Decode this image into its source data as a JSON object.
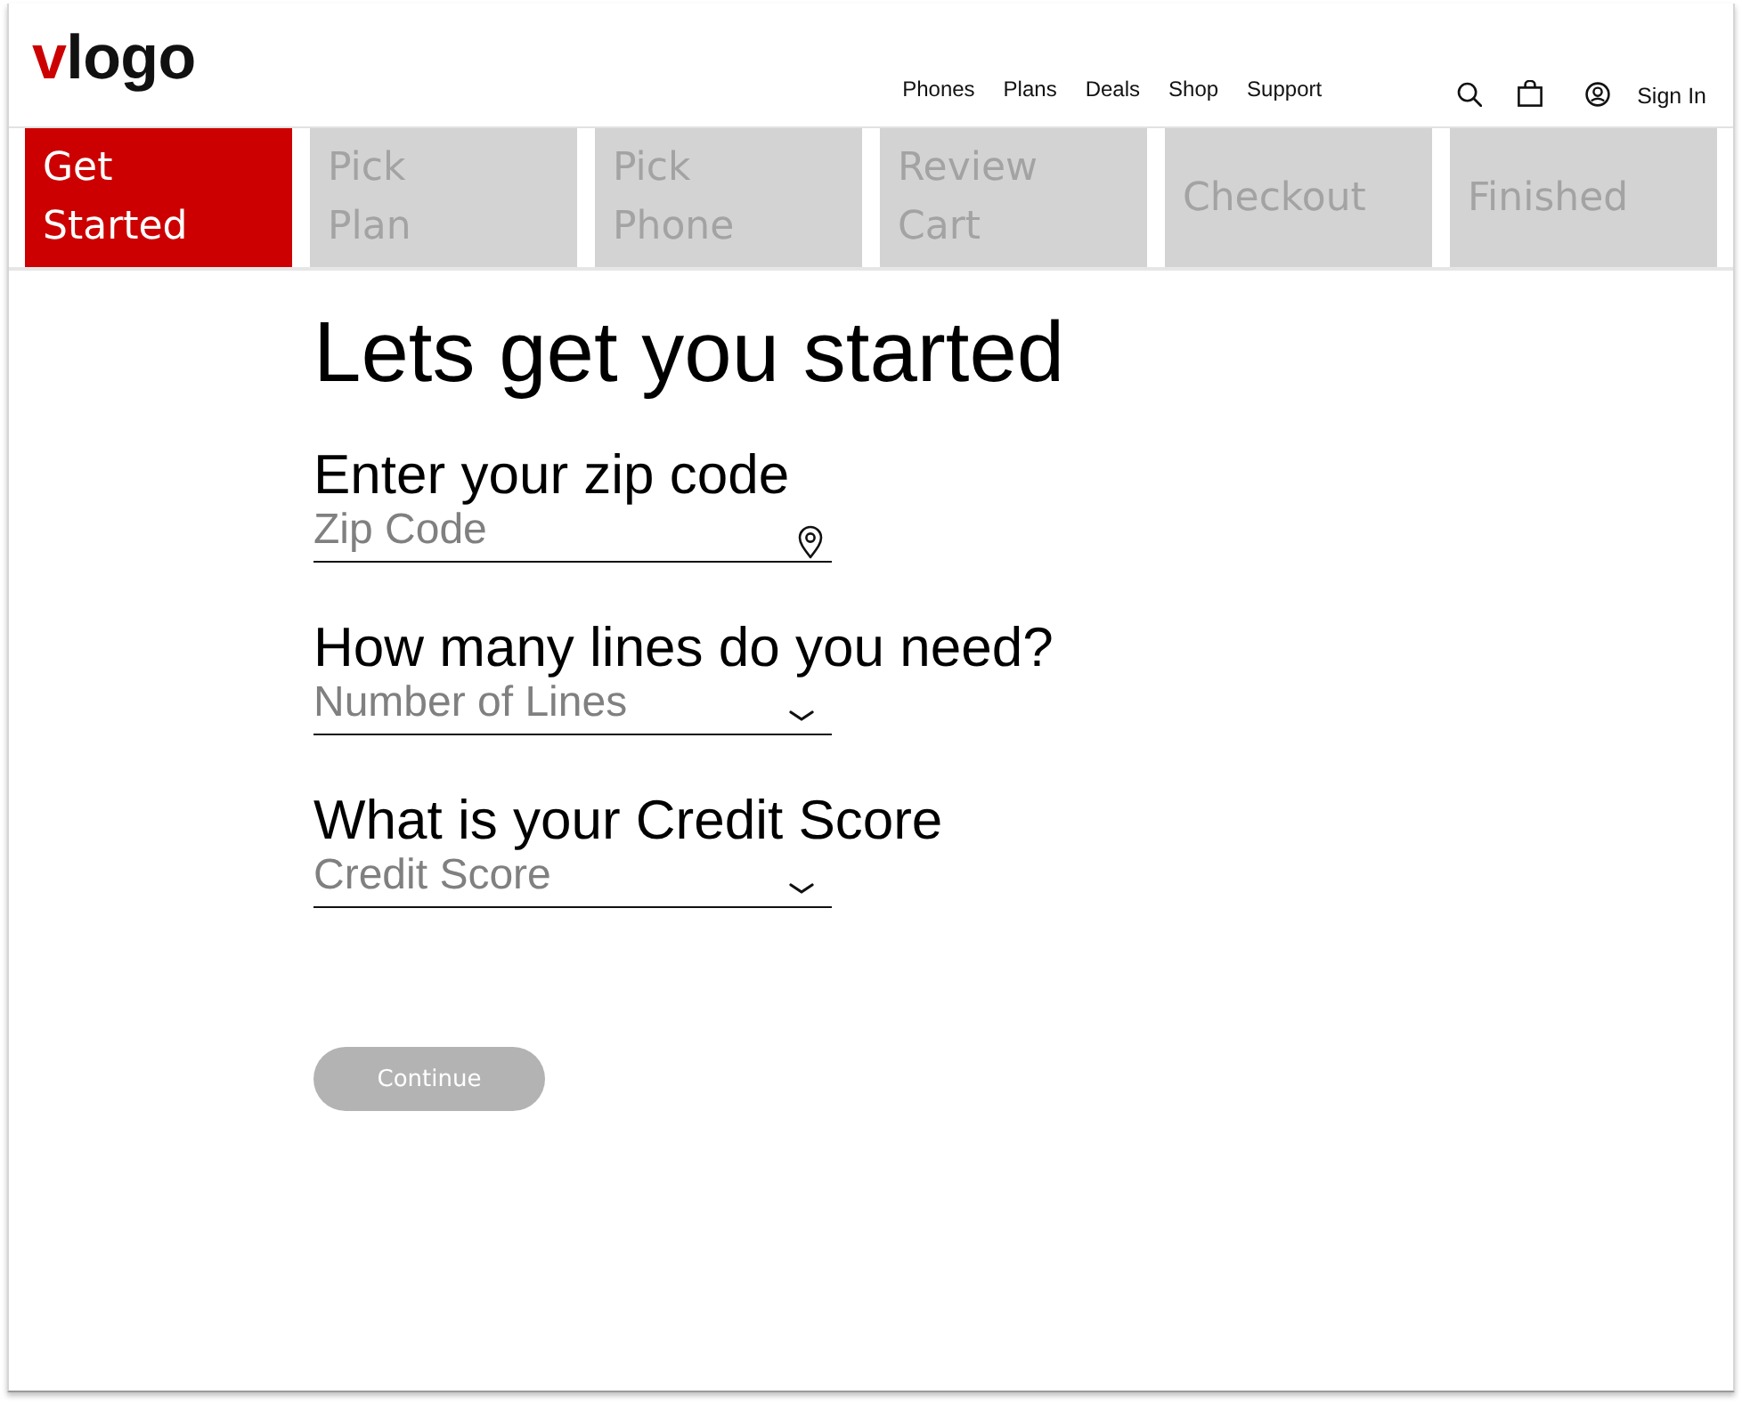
{
  "header": {
    "logo": {
      "accent": "v",
      "text": "logo"
    },
    "nav": [
      "Phones",
      "Plans",
      "Deals",
      "Shop",
      "Support"
    ],
    "sign_in": "Sign In"
  },
  "steps": [
    {
      "label": "Get Started",
      "selected": true
    },
    {
      "label": "Pick Plan",
      "selected": false
    },
    {
      "label": "Pick Phone",
      "selected": false
    },
    {
      "label": "Review Cart",
      "selected": false
    },
    {
      "label": "Checkout",
      "selected": false
    },
    {
      "label": "Finished",
      "selected": false
    }
  ],
  "form": {
    "title": "Lets get you started",
    "fields": [
      {
        "label": "Enter your zip code",
        "placeholder": "Zip Code",
        "kind": "location"
      },
      {
        "label": "How many lines do you need?",
        "placeholder": "Number of Lines",
        "kind": "dropdown"
      },
      {
        "label": "What is your Credit Score",
        "placeholder": "Credit Score",
        "kind": "dropdown"
      }
    ],
    "continue_button": {
      "label": "Continue",
      "disabled": true
    }
  }
}
